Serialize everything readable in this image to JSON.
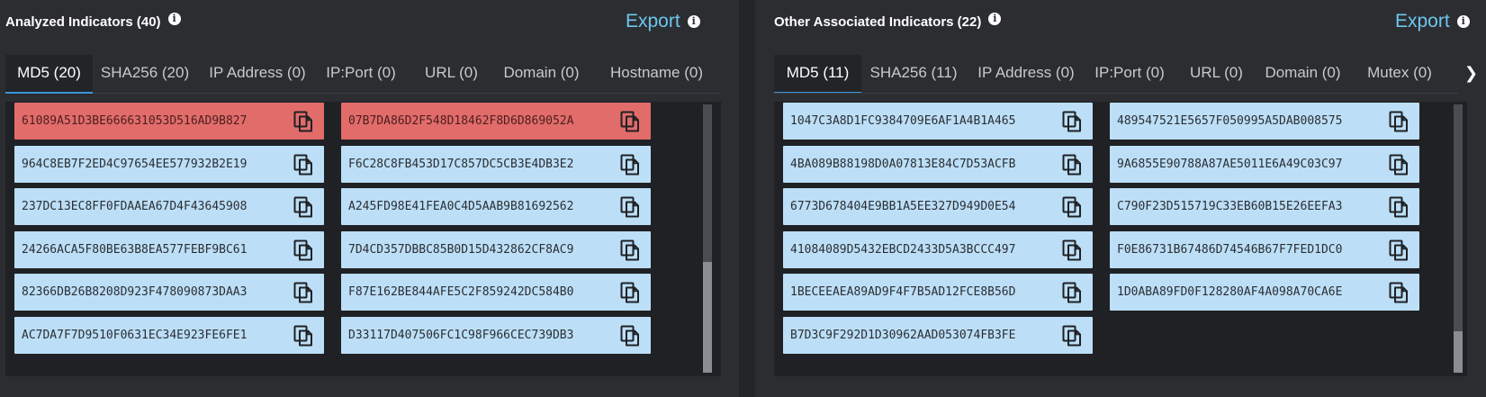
{
  "left": {
    "title": "Analyzed Indicators (40)",
    "export_label": "Export",
    "tabs": [
      "MD5 (20)",
      "SHA256 (20)",
      "IP Address (0)",
      "IP:Port (0)",
      "URL (0)",
      "Domain (0)",
      "Hostname (0)"
    ],
    "active_tab": "MD5 (20)",
    "hashes": [
      {
        "value": "61089A51D3BE666631053D516AD9B827",
        "status": "malicious"
      },
      {
        "value": "07B7DA86D2F548D18462F8D6D869052A",
        "status": "malicious"
      },
      {
        "value": "964C8EB7F2ED4C97654EE577932B2E19",
        "status": "normal"
      },
      {
        "value": "F6C28C8FB453D17C857DC5CB3E4DB3E2",
        "status": "normal"
      },
      {
        "value": "237DC13EC8FF0FDAAEA67D4F43645908",
        "status": "normal"
      },
      {
        "value": "A245FD98E41FEA0C4D5AAB9B81692562",
        "status": "normal"
      },
      {
        "value": "24266ACA5F80BE63B8EA577FEBF9BC61",
        "status": "normal"
      },
      {
        "value": "7D4CD357DBBC85B0D15D432862CF8AC9",
        "status": "normal"
      },
      {
        "value": "82366DB26B8208D923F478090873DAA3",
        "status": "normal"
      },
      {
        "value": "F87E162BE844AFE5C2F859242DC584B0",
        "status": "normal"
      },
      {
        "value": "AC7DA7F7D9510F0631EC34E923FE6FE1",
        "status": "normal"
      },
      {
        "value": "D33117D407506FC1C98F966CEC739DB3",
        "status": "normal"
      }
    ]
  },
  "right": {
    "title": "Other Associated Indicators (22)",
    "export_label": "Export",
    "tabs": [
      "MD5 (11)",
      "SHA256 (11)",
      "IP Address (0)",
      "IP:Port (0)",
      "URL (0)",
      "Domain (0)",
      "Mutex (0)"
    ],
    "active_tab": "MD5 (11)",
    "hashes": [
      {
        "value": "1047C3A8D1FC9384709E6AF1A4B1A465",
        "status": "normal"
      },
      {
        "value": "489547521E5657F050995A5DAB008575",
        "status": "normal"
      },
      {
        "value": "4BA089B88198D0A07813E84C7D53ACFB",
        "status": "normal"
      },
      {
        "value": "9A6855E90788A87AE5011E6A49C03C97",
        "status": "normal"
      },
      {
        "value": "6773D678404E9BB1A5EE327D949D0E54",
        "status": "normal"
      },
      {
        "value": "C790F23D515719C33EB60B15E26EEFA3",
        "status": "normal"
      },
      {
        "value": "41084089D5432EBCD2433D5A3BCCC497",
        "status": "normal"
      },
      {
        "value": "F0E86731B67486D74546B67F7FED1DC0",
        "status": "normal"
      },
      {
        "value": "1BECEEAEA89AD9F4F7B5AD12FCE8B56D",
        "status": "normal"
      },
      {
        "value": "1D0ABA89FD0F128280AF4A098A70CA6E",
        "status": "normal"
      },
      {
        "value": "B7D3C9F292D1D30962AAD053074FB3FE",
        "status": "normal"
      }
    ]
  },
  "icons": {
    "info": "info-icon",
    "copy": "copy-icon",
    "next": "chevron-right-icon"
  },
  "colors": {
    "accent": "#3b95d8",
    "export": "#6ec6ee",
    "chip_normal": "#bcdff7",
    "chip_malicious": "#e26c6a"
  }
}
